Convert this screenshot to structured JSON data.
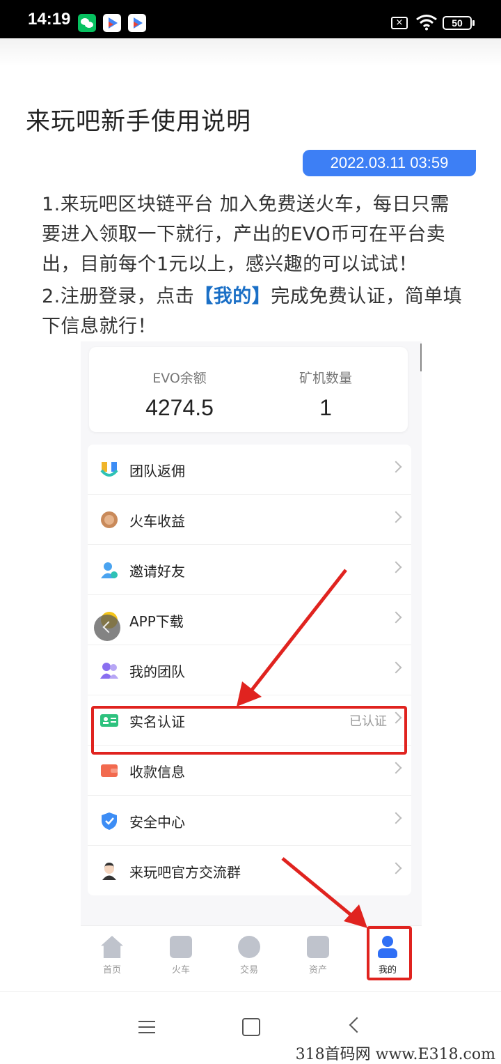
{
  "status_bar": {
    "time": "14:19",
    "battery": "50",
    "sim_icon": "no-sim-icon",
    "wifi_icon": "wifi-icon"
  },
  "article": {
    "title": "来玩吧新手使用说明",
    "date": "2022.03.11 03:59",
    "para1": "1.来玩吧区块链平台  加入免费送火车，每日只需要进入领取一下就行，产出的EVO币可在平台卖出，目前每个1元以上，感兴趣的可以试试！",
    "para2_prefix": "2.注册登录，点击",
    "para2_highlight": "【我的】",
    "para2_suffix": "完成免费认证，简单填下信息就行！"
  },
  "app": {
    "stats": [
      {
        "label": "EVO余额",
        "value": "4274.5"
      },
      {
        "label": "矿机数量",
        "value": "1"
      }
    ],
    "menu": [
      {
        "label": "团队返佣",
        "right": "",
        "icon": "team-rebate-icon",
        "color": "#f0b429"
      },
      {
        "label": "火车收益",
        "right": "",
        "icon": "coin-icon",
        "color": "#c98a5a"
      },
      {
        "label": "邀请好友",
        "right": "",
        "icon": "invite-friend-icon",
        "color": "#4aa3f0"
      },
      {
        "label": "APP下载",
        "right": "",
        "icon": "download-icon",
        "color": "#f5c518"
      },
      {
        "label": "我的团队",
        "right": "",
        "icon": "my-team-icon",
        "color": "#8a6ff0"
      },
      {
        "label": "实名认证",
        "right": "已认证",
        "icon": "id-card-icon",
        "color": "#2ec27e"
      },
      {
        "label": "收款信息",
        "right": "",
        "icon": "wallet-icon",
        "color": "#f26a4f"
      },
      {
        "label": "安全中心",
        "right": "",
        "icon": "shield-icon",
        "color": "#3d8df5"
      },
      {
        "label": "来玩吧官方交流群",
        "right": "",
        "icon": "support-agent-icon",
        "color": "#333333"
      }
    ],
    "tabs": [
      {
        "label": "首页",
        "icon": "home-icon"
      },
      {
        "label": "火车",
        "icon": "train-icon"
      },
      {
        "label": "交易",
        "icon": "trade-icon"
      },
      {
        "label": "资产",
        "icon": "wallet-icon"
      },
      {
        "label": "我的",
        "icon": "profile-icon"
      }
    ]
  },
  "colors": {
    "accent": "#3d7ff5",
    "highlight_text": "#1a6fc6",
    "annotation_red": "#e0231f",
    "active_tab": "#2f6ff5"
  },
  "watermark": "318首码网 www.E318.com"
}
